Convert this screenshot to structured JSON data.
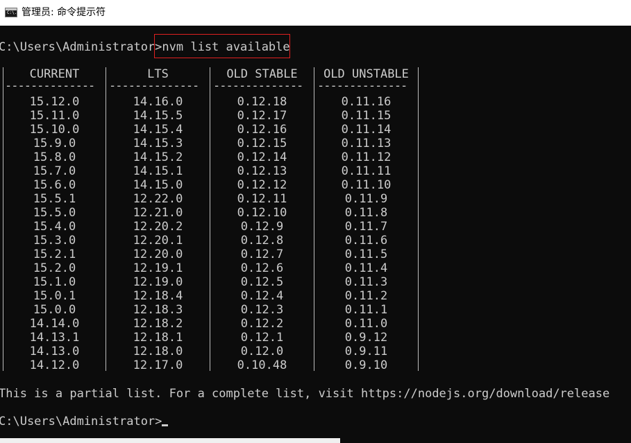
{
  "window": {
    "title": "管理员: 命令提示符",
    "icon_label": "C:\\."
  },
  "console": {
    "prompt1": "C:\\Users\\Administrator>",
    "command": "nvm list available",
    "partial_note": "This is a partial list. For a complete list, visit https://nodejs.org/download/release",
    "prompt2": "C:\\Users\\Administrator>"
  },
  "table": {
    "headers": [
      "CURRENT",
      "LTS",
      "OLD STABLE",
      "OLD UNSTABLE"
    ],
    "dashes": "--------------",
    "rows": [
      [
        "15.12.0",
        "14.16.0",
        "0.12.18",
        "0.11.16"
      ],
      [
        "15.11.0",
        "14.15.5",
        "0.12.17",
        "0.11.15"
      ],
      [
        "15.10.0",
        "14.15.4",
        "0.12.16",
        "0.11.14"
      ],
      [
        "15.9.0",
        "14.15.3",
        "0.12.15",
        "0.11.13"
      ],
      [
        "15.8.0",
        "14.15.2",
        "0.12.14",
        "0.11.12"
      ],
      [
        "15.7.0",
        "14.15.1",
        "0.12.13",
        "0.11.11"
      ],
      [
        "15.6.0",
        "14.15.0",
        "0.12.12",
        "0.11.10"
      ],
      [
        "15.5.1",
        "12.22.0",
        "0.12.11",
        "0.11.9"
      ],
      [
        "15.5.0",
        "12.21.0",
        "0.12.10",
        "0.11.8"
      ],
      [
        "15.4.0",
        "12.20.2",
        "0.12.9",
        "0.11.7"
      ],
      [
        "15.3.0",
        "12.20.1",
        "0.12.8",
        "0.11.6"
      ],
      [
        "15.2.1",
        "12.20.0",
        "0.12.7",
        "0.11.5"
      ],
      [
        "15.2.0",
        "12.19.1",
        "0.12.6",
        "0.11.4"
      ],
      [
        "15.1.0",
        "12.19.0",
        "0.12.5",
        "0.11.3"
      ],
      [
        "15.0.1",
        "12.18.4",
        "0.12.4",
        "0.11.2"
      ],
      [
        "15.0.0",
        "12.18.3",
        "0.12.3",
        "0.11.1"
      ],
      [
        "14.14.0",
        "12.18.2",
        "0.12.2",
        "0.11.0"
      ],
      [
        "14.13.1",
        "12.18.1",
        "0.12.1",
        "0.9.12"
      ],
      [
        "14.13.0",
        "12.18.0",
        "0.12.0",
        "0.9.11"
      ],
      [
        "14.12.0",
        "12.17.0",
        "0.10.48",
        "0.9.10"
      ]
    ]
  },
  "colors": {
    "background": "#0c0c0c",
    "text": "#cccccc",
    "highlight_border": "#e02020"
  }
}
